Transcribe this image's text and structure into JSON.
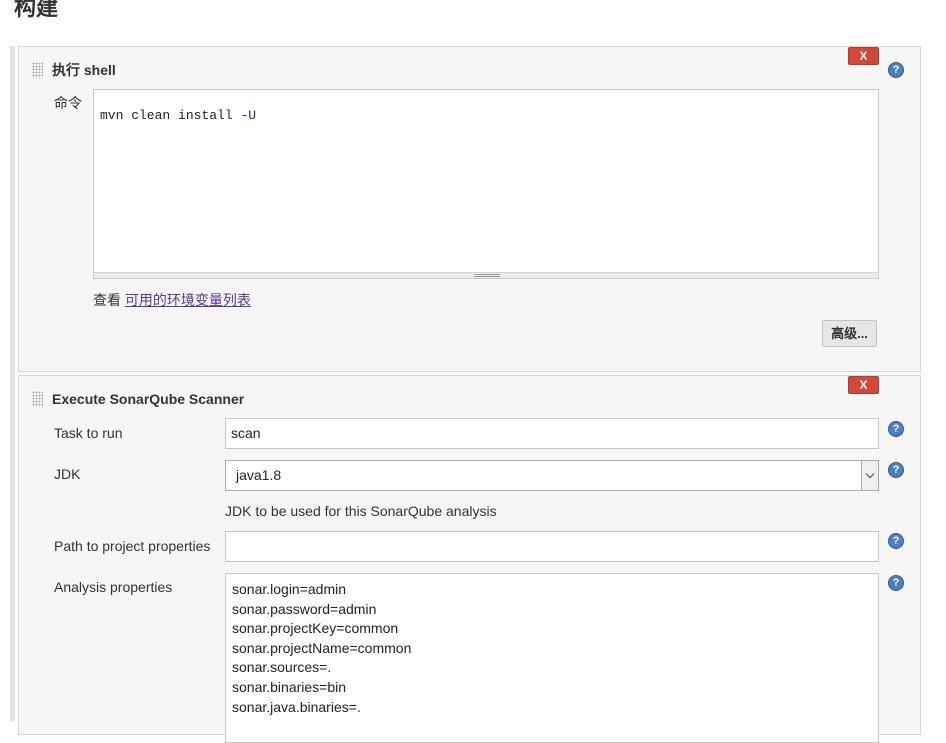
{
  "section": {
    "title": "构建"
  },
  "shell_step": {
    "title": "执行 shell",
    "delete_label": "X",
    "help": "?",
    "command_label": "命令",
    "command_main": "mvn clean install ",
    "command_flag": "-U",
    "env_prefix": "查看 ",
    "env_link": "可用的环境变量列表",
    "advanced_label": "高级..."
  },
  "sonar_step": {
    "title": "Execute SonarQube Scanner",
    "delete_label": "X",
    "help": "?",
    "task_label": "Task to run",
    "task_value": "scan",
    "jdk_label": "JDK",
    "jdk_selected": "java1.8",
    "jdk_hint": "JDK to be used for this SonarQube analysis",
    "path_label": "Path to project properties",
    "path_value": "",
    "analysis_label": "Analysis properties",
    "analysis_lines": [
      "sonar.login=admin",
      "sonar.password=admin",
      "sonar.projectKey=common",
      "sonar.projectName=common",
      "sonar.sources=.",
      "sonar.binaries=bin",
      "sonar.java.binaries=."
    ]
  },
  "colors": {
    "delete": "#d24939",
    "help": "#4c7fbf",
    "link": "#5b3796"
  }
}
